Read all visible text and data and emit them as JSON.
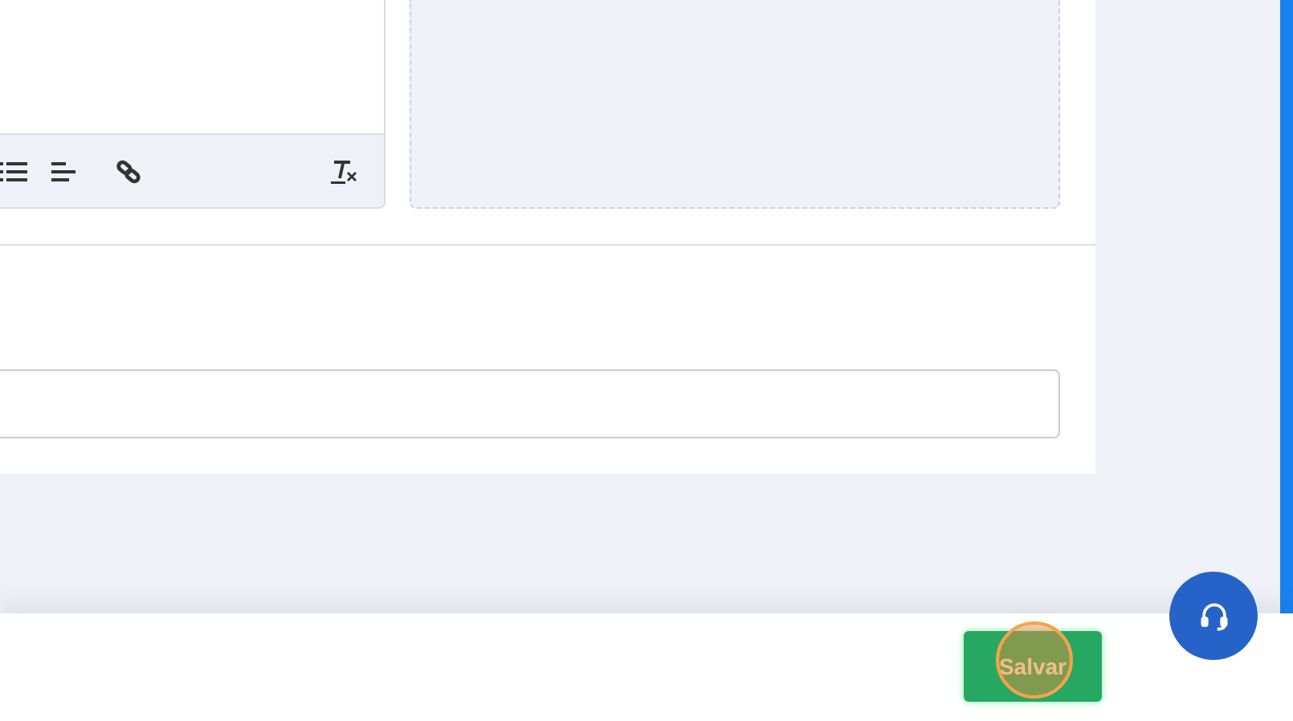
{
  "footer": {
    "save_button": "Salvar"
  }
}
